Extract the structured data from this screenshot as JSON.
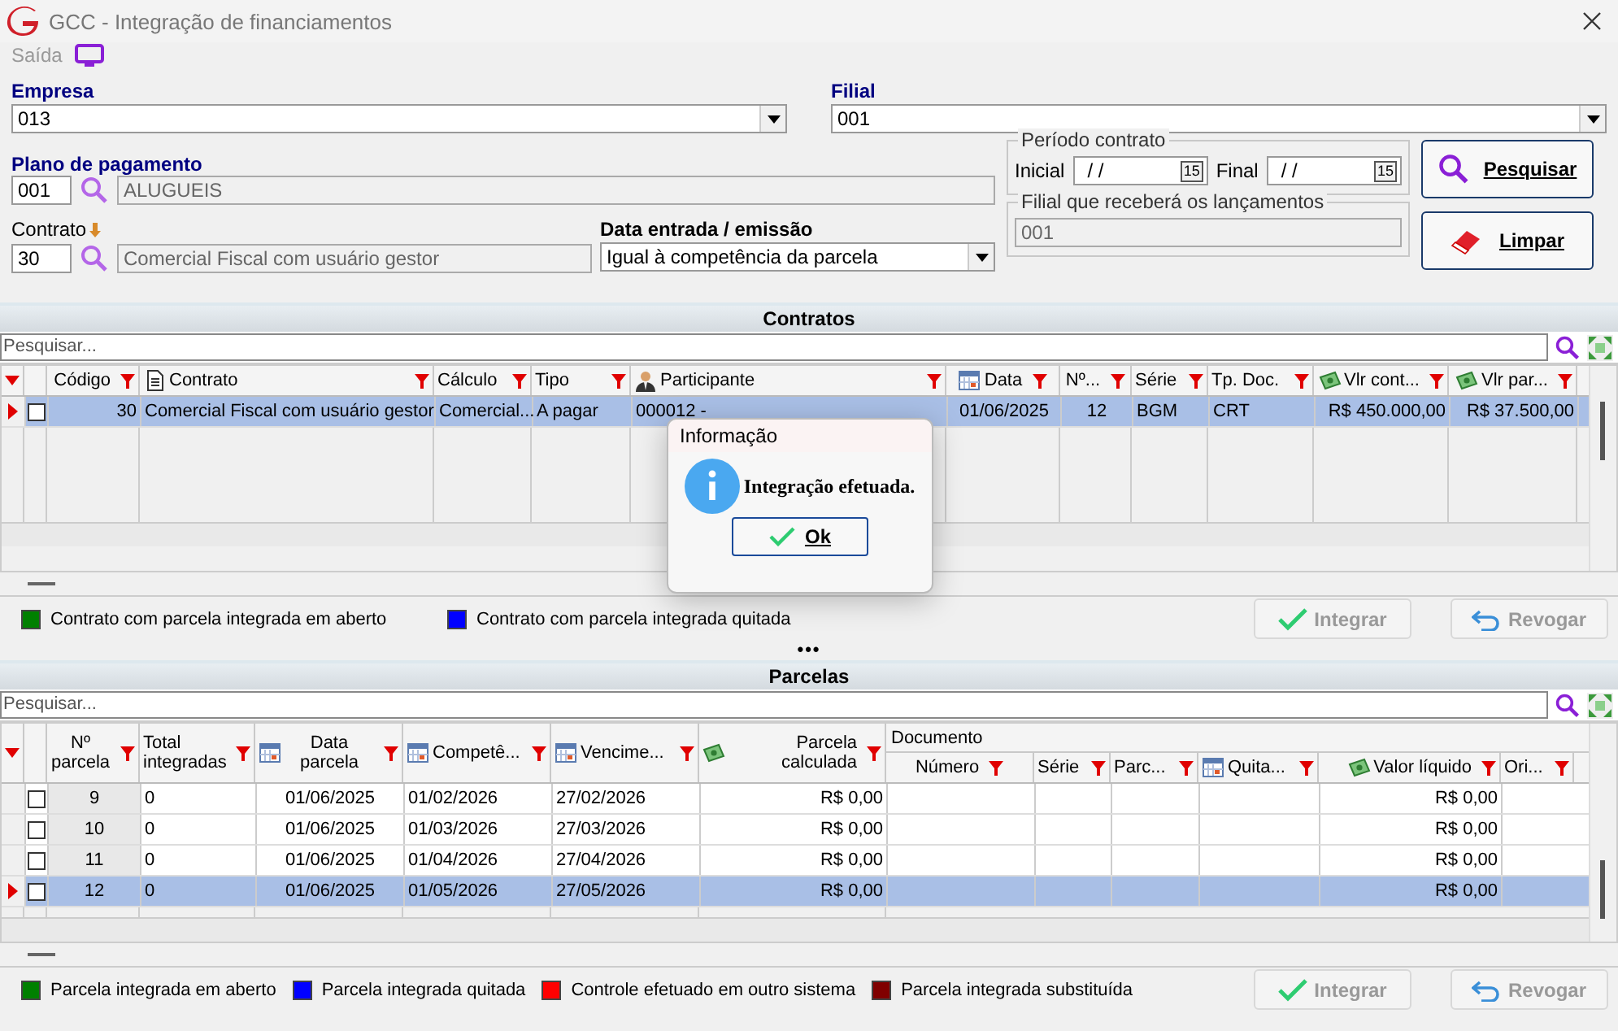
{
  "window": {
    "title": "GCC - Integração de financiamentos"
  },
  "menu": {
    "label": "Saída"
  },
  "form": {
    "empresa": {
      "label": "Empresa",
      "value": "013"
    },
    "filial": {
      "label": "Filial",
      "value": "001"
    },
    "plano": {
      "label": "Plano de pagamento",
      "code": "001",
      "name": "ALUGUEIS"
    },
    "contrato": {
      "label": "Contrato",
      "code": "30",
      "name": "Comercial Fiscal com usuário gestor"
    },
    "data_entrada": {
      "label": "Data entrada / emissão",
      "value": "Igual à competência da parcela"
    },
    "periodo": {
      "legend": "Período contrato",
      "inicial_label": "Inicial",
      "inicial_value": "/ /",
      "inicial_calendar": "15",
      "final_label": "Final",
      "final_value": "/ /",
      "final_calendar": "15"
    },
    "filial_lancamentos": {
      "legend": "Filial que receberá os lançamentos",
      "value": "001"
    },
    "buttons": [
      {
        "label": "Pesquisar",
        "kind": "search"
      },
      {
        "label": "Limpar",
        "kind": "eraser"
      }
    ]
  },
  "contratos": {
    "title": "Contratos",
    "search_placeholder": "Pesquisar...",
    "columns": [
      {
        "label": "Código",
        "kind": "text"
      },
      {
        "label": "Contrato",
        "kind": "document"
      },
      {
        "label": "Cálculo",
        "kind": "text"
      },
      {
        "label": "Tipo",
        "kind": "text"
      },
      {
        "label": "Participante",
        "kind": "person"
      },
      {
        "label": "Data",
        "kind": "calendar"
      },
      {
        "label": "Nº...",
        "kind": "text"
      },
      {
        "label": "Série",
        "kind": "text"
      },
      {
        "label": "Tp. Doc.",
        "kind": "text"
      },
      {
        "label": "Vlr cont...",
        "kind": "money"
      },
      {
        "label": "Vlr par...",
        "kind": "money"
      }
    ],
    "rows": [
      {
        "selected": true,
        "checked": false,
        "cells": [
          "30",
          "Comercial Fiscal com usuário gestor",
          "Comercial...",
          "A pagar",
          "000012 -",
          "01/06/2025",
          "12",
          "BGM",
          "CRT",
          "R$ 450.000,00",
          "R$ 37.500,00"
        ]
      }
    ],
    "legend": [
      {
        "label": "Contrato com parcela integrada em aberto",
        "color": "#008000"
      },
      {
        "label": "Contrato com parcela integrada quitada",
        "color": "#0000ff"
      }
    ],
    "buttons": [
      {
        "label": "Integrar",
        "kind": "check",
        "disabled": true
      },
      {
        "label": "Revogar",
        "kind": "undo",
        "disabled": true
      }
    ]
  },
  "splitter": "•••",
  "parcelas": {
    "title": "Parcelas",
    "search_placeholder": "Pesquisar...",
    "columns": [
      {
        "label": "Nº parcela",
        "kind": "text"
      },
      {
        "label": "Total integradas",
        "kind": "text"
      },
      {
        "label": "Data parcela",
        "kind": "calendar"
      },
      {
        "label": "Competê...",
        "kind": "calendar"
      },
      {
        "label": "Vencime...",
        "kind": "calendar"
      },
      {
        "label": "Parcela calculada",
        "kind": "money"
      }
    ],
    "group": {
      "label": "Documento",
      "columns": [
        {
          "label": "Número",
          "kind": "text"
        },
        {
          "label": "Série",
          "kind": "text"
        },
        {
          "label": "Parc...",
          "kind": "text"
        },
        {
          "label": "Quita...",
          "kind": "calendar"
        },
        {
          "label": "Valor líquido",
          "kind": "money"
        },
        {
          "label": "Ori...",
          "kind": "text"
        }
      ]
    },
    "rows": [
      {
        "selected": false,
        "checked": false,
        "number": "9",
        "total": "0",
        "data": "01/06/2025",
        "competencia": "01/02/2026",
        "vencimento": "27/02/2026",
        "calculada": "R$ 0,00",
        "liquido": "R$ 0,00"
      },
      {
        "selected": false,
        "checked": false,
        "number": "10",
        "total": "0",
        "data": "01/06/2025",
        "competencia": "01/03/2026",
        "vencimento": "27/03/2026",
        "calculada": "R$ 0,00",
        "liquido": "R$ 0,00"
      },
      {
        "selected": false,
        "checked": false,
        "number": "11",
        "total": "0",
        "data": "01/06/2025",
        "competencia": "01/04/2026",
        "vencimento": "27/04/2026",
        "calculada": "R$ 0,00",
        "liquido": "R$ 0,00"
      },
      {
        "selected": true,
        "checked": false,
        "number": "12",
        "total": "0",
        "data": "01/06/2025",
        "competencia": "01/05/2026",
        "vencimento": "27/05/2026",
        "calculada": "R$ 0,00",
        "liquido": "R$ 0,00"
      }
    ],
    "legend": [
      {
        "label": "Parcela integrada em aberto",
        "color": "#008000"
      },
      {
        "label": "Parcela integrada quitada",
        "color": "#0000ff"
      },
      {
        "label": "Controle efetuado em outro sistema",
        "color": "#ff0000"
      },
      {
        "label": "Parcela integrada substituída",
        "color": "#800000"
      }
    ],
    "buttons": [
      {
        "label": "Integrar",
        "kind": "check",
        "disabled": true
      },
      {
        "label": "Revogar",
        "kind": "undo",
        "disabled": true
      }
    ]
  },
  "dialog": {
    "title": "Informação",
    "message": "Integração efetuada.",
    "button": "Ok"
  }
}
